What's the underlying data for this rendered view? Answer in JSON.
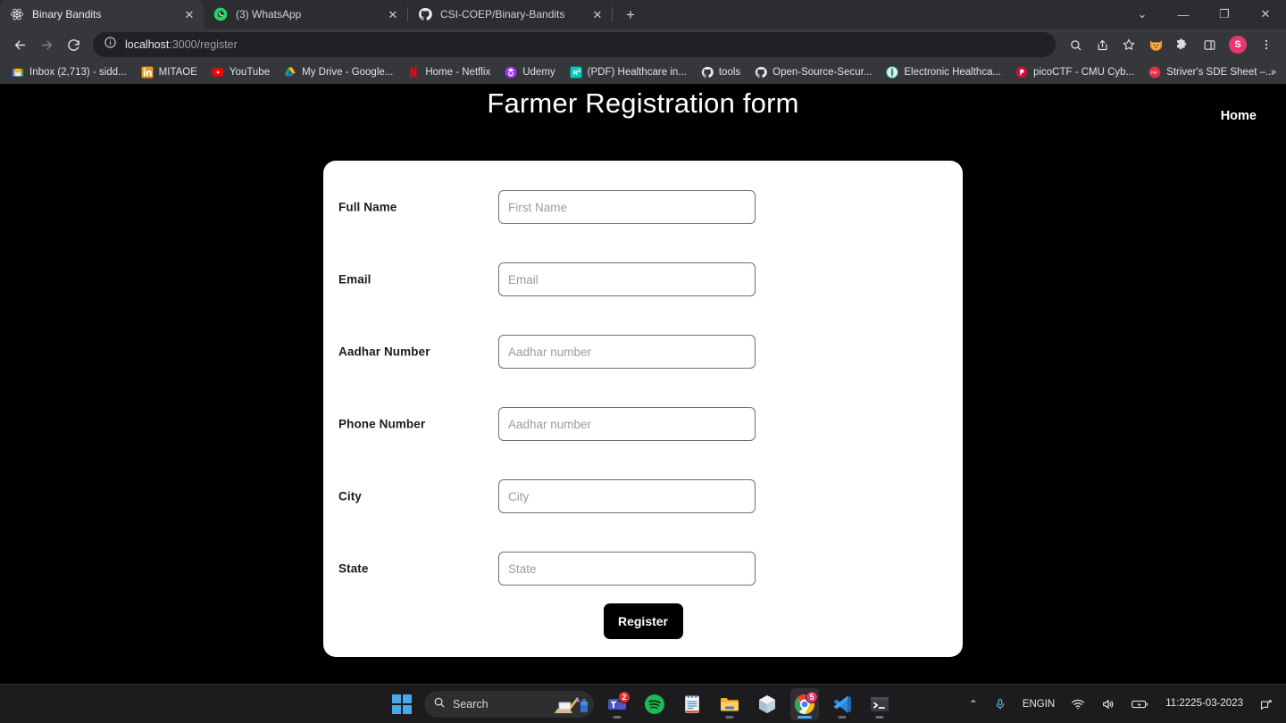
{
  "browser": {
    "tabs": [
      {
        "title": "Binary Bandits",
        "favicon": "react-icon",
        "active": true
      },
      {
        "title": "(3) WhatsApp",
        "favicon": "whatsapp-icon",
        "active": false
      },
      {
        "title": "CSI-COEP/Binary-Bandits",
        "favicon": "github-icon",
        "active": false
      }
    ],
    "new_tab_label": "+",
    "window_controls": {
      "minimize": "—",
      "maximize": "❐",
      "close": "✕",
      "tab_search": "⌄"
    },
    "nav": {
      "back": "←",
      "forward": "→",
      "reload": "↻"
    },
    "omnibox": {
      "site_info_icon": "info-circle-icon",
      "host": "localhost",
      "path": ":3000/register",
      "full_url": "localhost:3000/register"
    },
    "toolbar_icons": [
      "search-icon",
      "share-icon",
      "bookmark-star-icon",
      "fox-extension-icon",
      "extensions-puzzle-icon",
      "side-panel-icon"
    ],
    "profile_initial": "S",
    "menu_icon": "three-dots-menu-icon",
    "bookmarks": [
      {
        "label": "Inbox (2,713) - sidd...",
        "icon": "gmail-icon"
      },
      {
        "label": "MITAOE",
        "icon": "linkedin-icon"
      },
      {
        "label": "YouTube",
        "icon": "youtube-icon"
      },
      {
        "label": "My Drive - Google...",
        "icon": "google-drive-icon"
      },
      {
        "label": "Home - Netflix",
        "icon": "netflix-icon"
      },
      {
        "label": "Udemy",
        "icon": "udemy-icon"
      },
      {
        "label": "(PDF) Healthcare in...",
        "icon": "researchgate-icon"
      },
      {
        "label": "tools",
        "icon": "github-icon"
      },
      {
        "label": "Open-Source-Secur...",
        "icon": "github-icon"
      },
      {
        "label": "Electronic Healthca...",
        "icon": "sciencedirect-icon"
      },
      {
        "label": "picoCTF - CMU Cyb...",
        "icon": "picoctf-icon"
      },
      {
        "label": "Striver's SDE Sheet –...",
        "icon": "takeuforward-icon"
      }
    ],
    "bookmarks_overflow": "»"
  },
  "page": {
    "title": "Farmer Registration form",
    "nav_home": "Home",
    "form": {
      "fields": [
        {
          "label": "Full Name",
          "placeholder": "First Name",
          "value": ""
        },
        {
          "label": "Email",
          "placeholder": "Email",
          "value": ""
        },
        {
          "label": "Aadhar Number",
          "placeholder": "Aadhar number",
          "value": ""
        },
        {
          "label": "Phone Number",
          "placeholder": "Aadhar number",
          "value": ""
        },
        {
          "label": "City",
          "placeholder": "City",
          "value": ""
        },
        {
          "label": "State",
          "placeholder": "State",
          "value": ""
        }
      ],
      "submit_label": "Register"
    },
    "colors": {
      "background": "#000000",
      "card": "#ffffff",
      "button": "#000000",
      "text": "#ffffff"
    }
  },
  "taskbar": {
    "start_label": "start-windows-icon",
    "search_placeholder": "Search",
    "search_icon": "magnifier-icon",
    "apps": [
      {
        "name": "microsoft-teams-icon",
        "badge": "2",
        "running": true,
        "focused": false
      },
      {
        "name": "spotify-icon",
        "badge": "",
        "running": false,
        "focused": false
      },
      {
        "name": "notepad-icon",
        "badge": "",
        "running": false,
        "focused": false
      },
      {
        "name": "file-explorer-icon",
        "badge": "",
        "running": true,
        "focused": false
      },
      {
        "name": "virtualbox-icon",
        "badge": "",
        "running": false,
        "focused": false
      },
      {
        "name": "google-chrome-icon",
        "badge": "5",
        "running": true,
        "focused": true
      },
      {
        "name": "vs-code-icon",
        "badge": "",
        "running": true,
        "focused": false
      },
      {
        "name": "terminal-icon",
        "badge": "",
        "running": true,
        "focused": false
      }
    ],
    "tray": {
      "overflow": "⌃",
      "mic_icon": "microphone-icon",
      "language_line1": "ENG",
      "language_line2": "IN",
      "wifi_icon": "wifi-icon",
      "volume_icon": "speaker-icon",
      "battery_icon": "battery-charging-icon",
      "time": "11:22",
      "date": "25-03-2023",
      "notifications_icon": "notification-bell-icon"
    }
  }
}
